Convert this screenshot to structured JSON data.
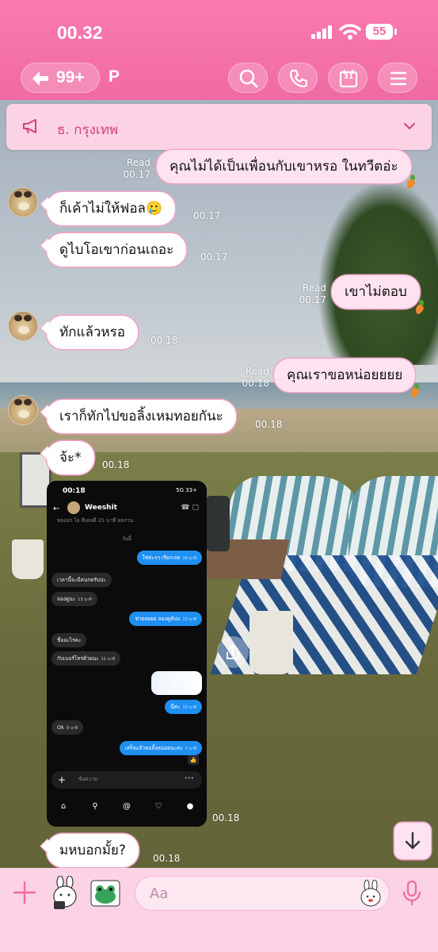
{
  "status": {
    "time": "00.32",
    "battery": "55"
  },
  "header": {
    "back_count": "99+",
    "chat_name": "P",
    "calendar_day": "31"
  },
  "announcement": {
    "text": "ธ. กรุงเทพ"
  },
  "messages": [
    {
      "dir": "out",
      "text": "คุณไม่ได้เป็นเพื่อนกับเขาหรอ ในทวีตอ่ะ",
      "read": "Read",
      "time": "00.17"
    },
    {
      "dir": "in",
      "text": "ก็เค้าไม่ให้ฟอล🥲",
      "time": "00.17"
    },
    {
      "dir": "in",
      "text": "ดูไบโอเขาก่อนเถอะ",
      "time": "00.17"
    },
    {
      "dir": "out",
      "text": "เขาไม่ตอบ",
      "read": "Read",
      "time": "00.17"
    },
    {
      "dir": "in",
      "text": "ทักแล้วหรอ",
      "time": "00.18"
    },
    {
      "dir": "out",
      "text": "คุณเราขอหน่อยยยย",
      "read": "Read",
      "time": "00.18"
    },
    {
      "dir": "in",
      "text": "เราก็ทักไปขอลิ้งเหมทอยกันะ",
      "time": "00.18"
    },
    {
      "dir": "in",
      "text": "จ้ะ*",
      "time": "00.18"
    },
    {
      "dir": "in",
      "type": "image",
      "time": "00.18"
    },
    {
      "dir": "in",
      "text": "มหบอกมั้ย?",
      "time": "00.18"
    }
  ],
  "embedded_screenshot": {
    "time": "00:18",
    "status": "5G 33+",
    "contact": "Weeshit",
    "date_label": "วันนี้",
    "top_cut": "หลงอก ไอ ทีเคลดี  25 นาที ผลก่วน",
    "messages": [
      {
        "dir": "out",
        "text": "ใช่ค่ะๆๆ เรียกเลย",
        "time": "16 นาที"
      },
      {
        "dir": "in",
        "text": "เวลานี้จะมีคนกดรับปะ",
        "time": ""
      },
      {
        "dir": "in",
        "text": "ลองดูนะ",
        "time": "13 นาที"
      },
      {
        "dir": "out",
        "text": "ช่วยยยยย ลองดูค้บบ",
        "time": "13 นาที"
      },
      {
        "dir": "in",
        "text": "ชื่ออะไรคะ",
        "time": ""
      },
      {
        "dir": "in",
        "text": "กับเบอร์โทรด้วยนะ",
        "time": "11 นาที"
      },
      {
        "dir": "out",
        "text": "นี่ค่ะ",
        "time": "10 นาที"
      },
      {
        "dir": "in",
        "text": "Ok",
        "time": "9 นาที"
      },
      {
        "dir": "out",
        "text": "เสร็จแล้วขอลิ้งหน่อยนะคะ",
        "time": "7 นาที"
      }
    ],
    "input_placeholder": "ข้อความ"
  },
  "input": {
    "placeholder": "Aa"
  },
  "colors": {
    "header": "#f06aa3",
    "bubble_border": "#f4a3c5",
    "input_bar": "#fbd3e5",
    "accent_text": "#d63f7f"
  }
}
